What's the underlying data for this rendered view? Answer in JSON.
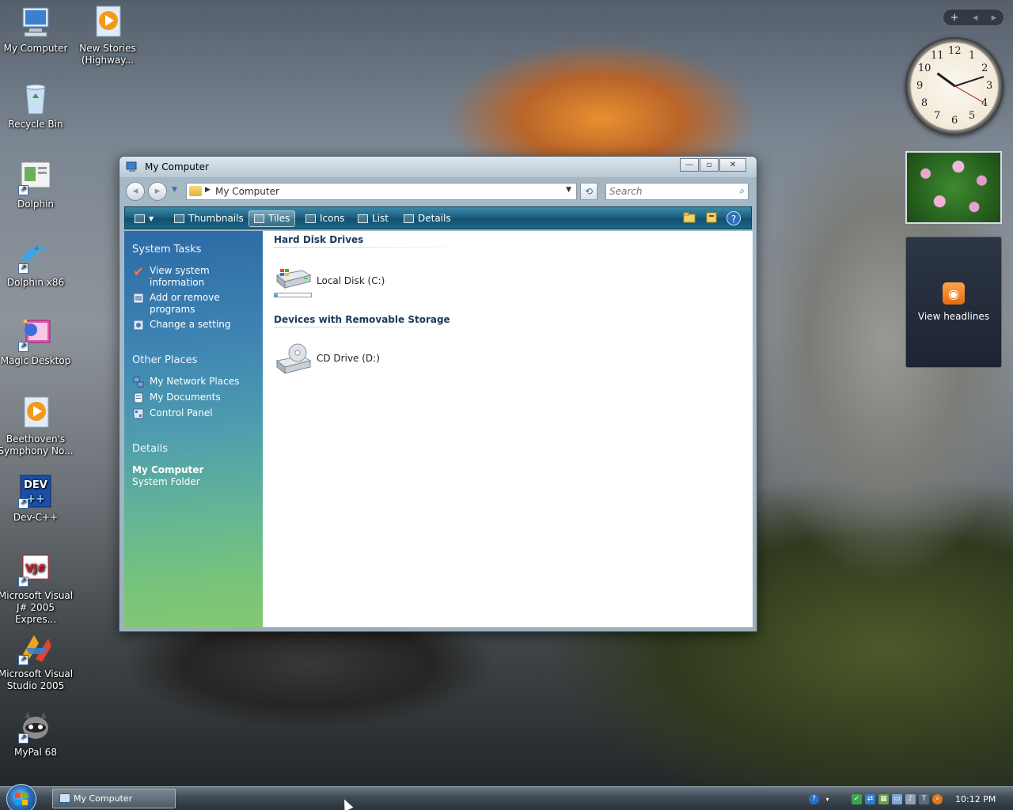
{
  "desktop_icons": [
    {
      "label": "My Computer",
      "icon": "computer-icon"
    },
    {
      "label": "New Stories (Highway...",
      "icon": "media-file-icon"
    },
    {
      "label": "Recycle Bin",
      "icon": "recycle-bin-icon"
    },
    {
      "label": "Dolphin",
      "icon": "dolphin-doc-icon"
    },
    {
      "label": "Dolphin x86",
      "icon": "dolphin-icon"
    },
    {
      "label": "Magic Desktop",
      "icon": "magic-desktop-icon"
    },
    {
      "label": "Beethoven's Symphony No...",
      "icon": "media-file-icon"
    },
    {
      "label": "Dev-C++",
      "icon": "dev-cpp-icon"
    },
    {
      "label": "Microsoft Visual J# 2005 Expres...",
      "icon": "vjsharp-icon"
    },
    {
      "label": "Microsoft Visual Studio 2005",
      "icon": "visual-studio-icon"
    },
    {
      "label": "MyPal 68",
      "icon": "mypal-icon"
    }
  ],
  "gadgets": {
    "clock_numbers": [
      "12",
      "1",
      "2",
      "3",
      "4",
      "5",
      "6",
      "7",
      "8",
      "9",
      "10",
      "11"
    ],
    "feed_label": "View headlines",
    "toolbar": {
      "add": "+",
      "prev": "◂",
      "next": "▸"
    }
  },
  "window": {
    "title": "My Computer",
    "controls": {
      "minimize": "—",
      "maximize": "▫",
      "close": "✕"
    },
    "address": {
      "crumb": "My Computer",
      "search_placeholder": "Search"
    },
    "toolbar": {
      "items": [
        "Thumbnails",
        "Tiles",
        "Icons",
        "List",
        "Details"
      ],
      "active": "Tiles"
    },
    "sidepane": {
      "system_tasks_title": "System Tasks",
      "system_tasks": [
        "View system information",
        "Add or remove programs",
        "Change a setting"
      ],
      "other_places_title": "Other Places",
      "other_places": [
        "My Network Places",
        "My Documents",
        "Control Panel"
      ],
      "details_title": "Details",
      "details_name": "My Computer",
      "details_type": "System Folder"
    },
    "content": {
      "groups": [
        {
          "title": "Hard Disk Drives",
          "items": [
            {
              "name": "Local Disk (C:)",
              "usage": 0.08
            }
          ]
        },
        {
          "title": "Devices with Removable Storage",
          "items": [
            {
              "name": "CD Drive (D:)"
            }
          ]
        }
      ]
    }
  },
  "taskbar": {
    "task_label": "My Computer",
    "time": "10:12 PM"
  },
  "colors": {
    "toolbar": "#1c5f80",
    "sidepane_top": "#2c6aa6",
    "sidepane_bottom": "#84c872",
    "group_heading": "#1e395b"
  }
}
